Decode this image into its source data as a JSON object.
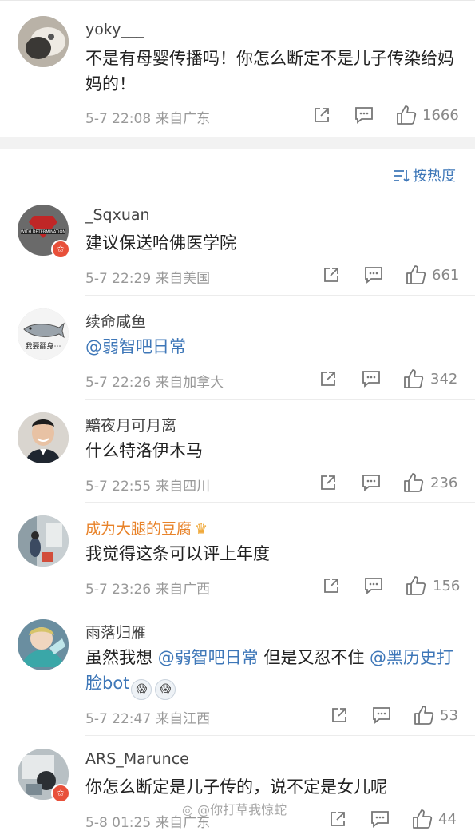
{
  "sort_label": "按热度",
  "watermark": "@你打草我惊蛇",
  "comments": [
    {
      "username": "yoky___",
      "text": "不是有母婴传播吗！你怎么断定不是儿子传染给妈妈的！",
      "time": "5-7 22:08",
      "location": "来自广东",
      "likes": "1666"
    },
    {
      "username": "_Sqxuan",
      "text": "建议保送哈佛医学院",
      "time": "5-7 22:29",
      "location": "来自美国",
      "likes": "661",
      "avatar_text": "WITH DETERMINATION"
    },
    {
      "username": "续命咸鱼",
      "mention": "@弱智吧日常",
      "time": "5-7 22:26",
      "location": "来自加拿大",
      "likes": "342",
      "avatar_text": "我要翻身⋯"
    },
    {
      "username": "黯夜月可月离",
      "text": "什么特洛伊木马",
      "time": "5-7 22:55",
      "location": "来自四川",
      "likes": "236"
    },
    {
      "username": "成为大腿的豆腐",
      "text": "我觉得这条可以评上年度",
      "time": "5-7 23:26",
      "location": "来自广西",
      "likes": "156"
    },
    {
      "username": "雨落归雁",
      "text_a": "虽然我想 ",
      "mention_a": "@弱智吧日常",
      "text_b": " 但是又忍不住 ",
      "mention_b": "@黑历史打脸bot",
      "time": "5-7 22:47",
      "location": "来自江西",
      "likes": "53"
    },
    {
      "username": "ARS_Marunce",
      "text": "你怎么断定是儿子传的，说不定是女儿呢",
      "time": "5-8 01:25",
      "location": "来自广东",
      "likes": "44"
    }
  ],
  "colors": {
    "accent": "#3e77b8",
    "vip": "#e8832a",
    "badge": "#e8503a"
  }
}
